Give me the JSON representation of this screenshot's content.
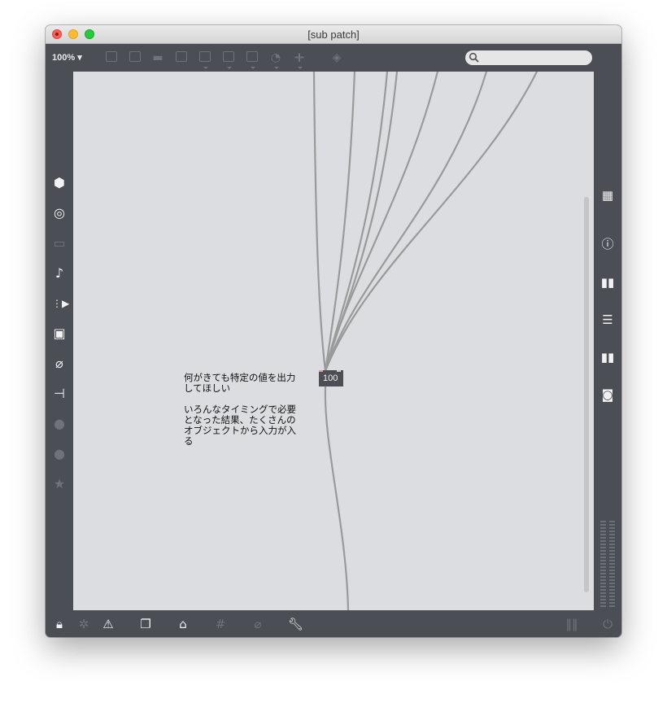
{
  "window": {
    "title": "[sub patch]"
  },
  "toolbar": {
    "zoom_label": "100%",
    "search_placeholder": ""
  },
  "patch": {
    "number_box_value": "100",
    "comment_text": "何がきても特定の値を出力してほしい\n\nいろんなタイミングで必要となった結果、たくさんのオブジェクトから入力が入る"
  },
  "colors": {
    "chrome": "#4b4f55",
    "canvas": "#dcdde0",
    "cable": "#9a9a9a",
    "icon_active": "#f2f2f2",
    "icon_dim": "#6e737a"
  },
  "icons": {
    "left_sidebar": [
      "cube-icon",
      "target-icon",
      "presentation-icon",
      "music-note-icon",
      "media-icon",
      "image-icon",
      "paperclip-icon",
      "plug-icon",
      "v-icon",
      "b-icon",
      "star-icon"
    ],
    "right_sidebar": [
      "grid-icon",
      "info-icon",
      "book-open-icon",
      "list-icon",
      "reference-icon",
      "snapshot-icon"
    ],
    "bottom_bar": [
      "lock-icon",
      "debug-icon",
      "warning-icon",
      "windows-icon",
      "presentation-mode-icon",
      "grid-icon",
      "add-connection-icon",
      "wrench-icon",
      "mixer-icon",
      "power-icon"
    ]
  }
}
